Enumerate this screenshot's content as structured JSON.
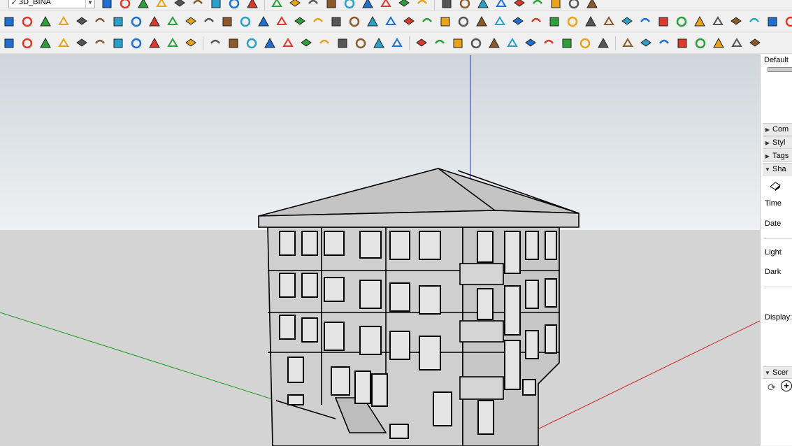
{
  "layer_selector": {
    "check": "✓",
    "value": "3D_BINA"
  },
  "toolbar_rows": {
    "row1": [
      "select-arrow-icon",
      "eraser-icon",
      "pencil-icon",
      "arc-icon",
      "paint-bucket-icon",
      "rectangle-icon",
      "push-pull-icon",
      "move-icon",
      "rotate-icon",
      "scale-icon",
      "tape-measure-icon",
      "text-icon",
      "protractor-icon",
      "orbit-icon",
      "pan-icon",
      "zoom-icon",
      "zoom-extents-icon",
      "section-plane-icon",
      "layers-icon",
      "user-icon",
      "home-icon",
      "house-icon",
      "house-outline-icon",
      "house-front-icon",
      "stack-icon",
      "stack-alt-icon",
      "stack-blue-icon"
    ],
    "row2": [
      "blue-tile-icon",
      "blue-tile-alt-icon",
      "yellow-tile-icon",
      "green-tile-icon",
      "red-tile-icon",
      "white-tile-icon",
      "spiral-icon",
      "red-square-icon",
      "box-icon",
      "flag-icon",
      "roll-icon",
      "tool-icon",
      "curve-icon",
      "dots-curve-icon",
      "red-cross-icon",
      "green-cross-icon",
      "blue-x-icon",
      "cone-icon",
      "pyramid-icon",
      "triangle-icon",
      "loop-icon",
      "loop-alt-icon",
      "spiral-shell-icon",
      "knot-icon",
      "star-node-icon",
      "cup-icon",
      "hook-icon",
      "puzzle-icon",
      "boxes-icon",
      "boxes-alt-icon",
      "boxes-red-icon",
      "boxes-gray-icon",
      "gem-icon",
      "nodes-icon",
      "nodes-red-icon",
      "grid-orange-icon",
      "grid-yellow-icon",
      "grid-tan-icon",
      "dots-red-icon",
      "circle-dots-icon",
      "matrix-icon",
      "cube-dark-icon",
      "copy-icon",
      "copy-alt-icon",
      "file-icon"
    ],
    "row3": [
      "logo-e-icon",
      "refresh-icon",
      "stack-orange-icon",
      "plus-circle-icon",
      "tree-icon",
      "sun-wedge-icon",
      "checker-icon",
      "cloud-upload-icon",
      "settings-icon",
      "mail-icon",
      "info-icon",
      "line-tool-icon",
      "arc-tool-icon",
      "eraser-tool-icon",
      "cut-tool-icon",
      "shape-tool-icon",
      "shape-alt-icon",
      "bend-tool-icon",
      "block-tool-icon",
      "sphere-tool-icon",
      "cursor-tool-icon",
      "angle-tool-icon",
      "angle-alt-icon",
      "slope-tool-icon",
      "wedge-tool-icon",
      "stamp-tool-icon",
      "bucket-tool-icon",
      "cone-tool-icon",
      "columns-icon",
      "columns-alt-icon",
      "hand-icon",
      "flag-tool-icon",
      "fold-icon",
      "stair-icon",
      "wave-icon",
      "wave-alt-icon",
      "spring-icon",
      "pipe-icon",
      "ramp-icon",
      "door-icon",
      "wall-icon"
    ]
  },
  "panel": {
    "header": "Default",
    "trays": [
      {
        "label": "Com",
        "expanded": false
      },
      {
        "label": "Styl",
        "expanded": false
      },
      {
        "label": "Tags",
        "expanded": false
      },
      {
        "label": "Sha",
        "expanded": true
      }
    ],
    "shadow_labels": {
      "time": "Time",
      "date": "Date",
      "light": "Light",
      "dark": "Dark",
      "display": "Display:"
    },
    "scenes_tray": {
      "label": "Scer",
      "expanded": true
    }
  },
  "colors": {
    "sky": "#dde3e8",
    "ground": "#d4d4d4",
    "axis_red": "#d02020",
    "axis_green": "#1a9a1a",
    "axis_blue": "#2a2ad0",
    "wall": "#cfcfcf",
    "roof": "#c4c4c4"
  }
}
